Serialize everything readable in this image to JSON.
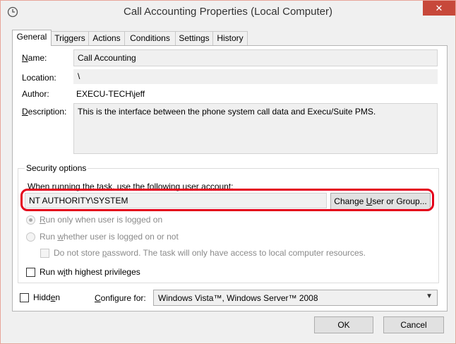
{
  "window": {
    "title": "Call Accounting Properties (Local Computer)",
    "close_glyph": "✕"
  },
  "tabs": [
    {
      "label": "General"
    },
    {
      "label": "Triggers"
    },
    {
      "label": "Actions"
    },
    {
      "label": "Conditions"
    },
    {
      "label": "Settings"
    },
    {
      "label": "History"
    }
  ],
  "general": {
    "name_label": "ame:",
    "name_underline": "N",
    "name_value": "Call Accounting",
    "location_label": "Location:",
    "location_value": "\\",
    "author_label": "Author:",
    "author_value": "EXECU-TECH\\jeff",
    "description_label": "escription:",
    "description_underline": "D",
    "description_value": "This is the interface between the phone system call data and Execu/Suite PMS."
  },
  "security": {
    "group_title": "Security options",
    "account_prompt": "When running the task, use the following user account:",
    "account_value": "NT AUTHORITY\\SYSTEM",
    "change_button_pre": "Change ",
    "change_button_u": "U",
    "change_button_post": "ser or Group...",
    "radio_logged_on_u": "R",
    "radio_logged_on_rest": "un only when user is logged on",
    "radio_whether_pre": "Run ",
    "radio_whether_u": "w",
    "radio_whether_post": "hether user is logged on or not",
    "no_store_pre": "Do not store ",
    "no_store_u": "p",
    "no_store_post": "assword.  The task will only have access to local computer resources.",
    "highest_pre": "Run w",
    "highest_u": "i",
    "highest_post": "th highest privileges"
  },
  "footer": {
    "hidden_pre": "Hidd",
    "hidden_u": "e",
    "hidden_post": "n",
    "configure_u": "C",
    "configure_rest": "onfigure for:",
    "configure_value": "Windows Vista™, Windows Server™ 2008",
    "ok_label": "OK",
    "cancel_label": "Cancel"
  },
  "colors": {
    "highlight": "#e4001b",
    "close_button": "#c7483a"
  }
}
